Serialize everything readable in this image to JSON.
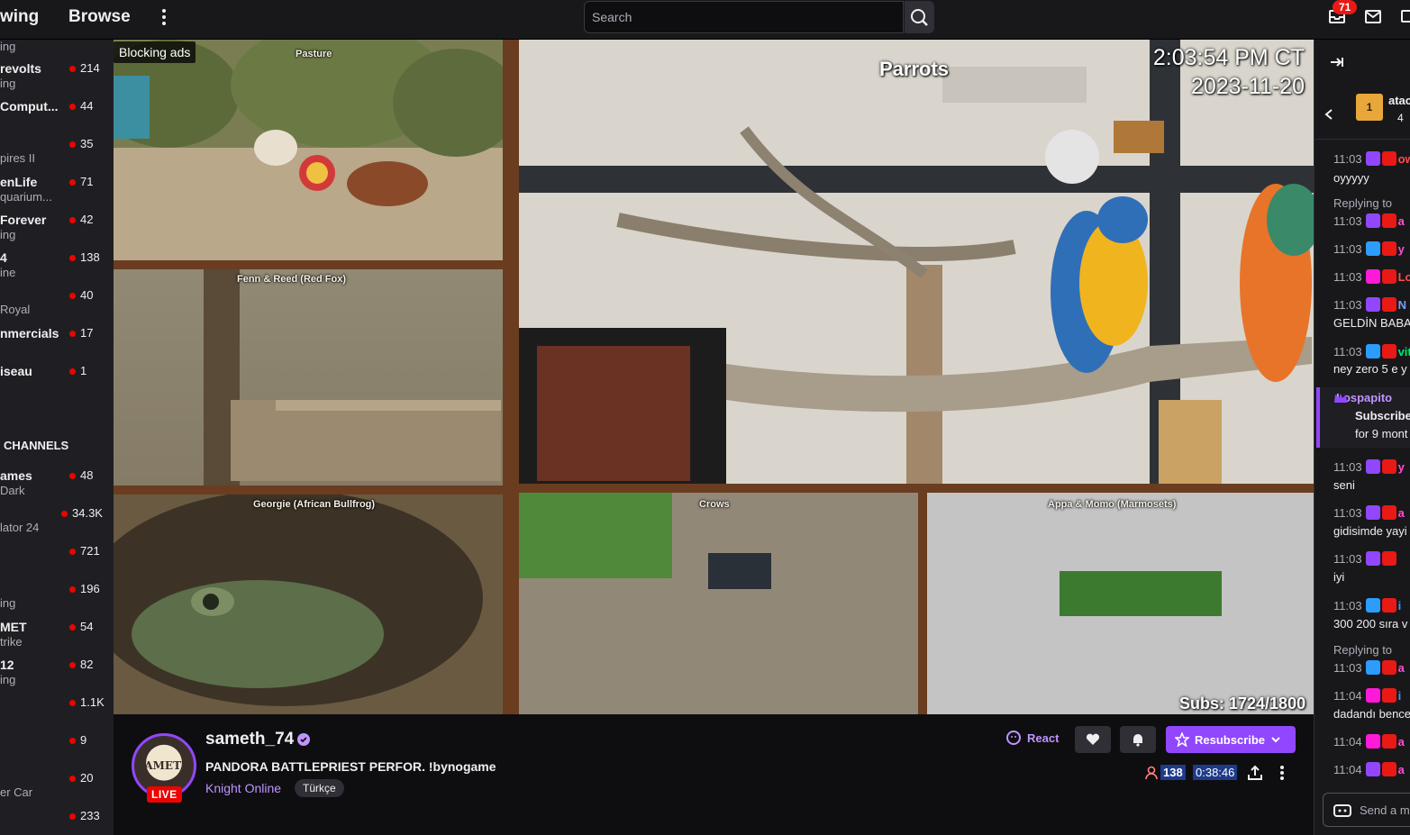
{
  "topnav": {
    "following_label": "wing",
    "browse_label": "Browse",
    "search_placeholder": "Search",
    "notifications_count": "71"
  },
  "sidebar": {
    "channels": [
      {
        "name": "",
        "game": "ing",
        "count": ""
      },
      {
        "name": "revolts",
        "game": "ing",
        "count": "214"
      },
      {
        "name": "Comput...",
        "game": "",
        "count": "44"
      },
      {
        "name": "",
        "game": "",
        "count": "35"
      },
      {
        "name": "",
        "game": "pires II",
        "count": ""
      },
      {
        "name": "enLife",
        "game": "quarium...",
        "count": "71"
      },
      {
        "name": "Forever",
        "game": "ing",
        "count": "42"
      },
      {
        "name": "4",
        "game": "ine",
        "count": "138"
      },
      {
        "name": "",
        "game": "",
        "count": "40"
      },
      {
        "name": "",
        "game": "Royal",
        "count": ""
      },
      {
        "name": "nmercials",
        "game": "",
        "count": "17"
      },
      {
        "name": "iseau",
        "game": "",
        "count": "1"
      }
    ],
    "heading": "CHANNELS",
    "recommended": [
      {
        "name": "ames",
        "game": "Dark",
        "count": "48"
      },
      {
        "name": "",
        "game": "",
        "count": "34.3K"
      },
      {
        "name": "",
        "game": "lator 24",
        "count": ""
      },
      {
        "name": "",
        "game": "",
        "count": "721"
      },
      {
        "name": "",
        "game": "",
        "count": "196"
      },
      {
        "name": "",
        "game": "ing",
        "count": ""
      },
      {
        "name": "MET",
        "game": "trike",
        "count": "54"
      },
      {
        "name": "12",
        "game": "ing",
        "count": "82"
      },
      {
        "name": "",
        "game": "",
        "count": "1.1K"
      },
      {
        "name": "",
        "game": "",
        "count": "9"
      },
      {
        "name": "",
        "game": "",
        "count": "20"
      },
      {
        "name": "",
        "game": "er Car",
        "count": ""
      },
      {
        "name": "",
        "game": "",
        "count": "233"
      }
    ]
  },
  "video": {
    "blocking_ads": "Blocking ads",
    "cam_labels": {
      "pasture": "Pasture",
      "fox": "Fenn & Reed (Red Fox)",
      "frog": "Georgie (African Bullfrog)",
      "crows": "Crows",
      "marmosets": "Appa & Momo (Marmosets)"
    },
    "parrots_label": "Parrots",
    "time": "2:03:54 PM CT",
    "date": "2023-11-20",
    "subs": "Subs: 1724/1800"
  },
  "channel": {
    "name": "sameth_74",
    "avatar_text": "SAMETH",
    "live": "LIVE",
    "title": "PANDORA BATTLEPRIEST PERFOR. !bynogame",
    "game": "Knight Online",
    "tag": "Türkçe",
    "react_label": "React",
    "resubscribe_label": "Resubscribe",
    "viewers": "138",
    "uptime": "0:38:46"
  },
  "chat": {
    "pinned_user": "atac",
    "pinned_count": "4",
    "lines": [
      {
        "time": "11:03",
        "user": "own",
        "color": "#ff4d4d",
        "text": ""
      },
      {
        "time": "",
        "user": "",
        "color": "#efeff1",
        "text": "oyyyyy"
      },
      {
        "time": "",
        "user": "",
        "color": "#adadb8",
        "text": "Replying to"
      },
      {
        "time": "11:03",
        "user": "a",
        "color": "#ff4dd2",
        "text": ""
      },
      {
        "time": "11:03",
        "user": "y",
        "color": "#ff4dd2",
        "text": ""
      },
      {
        "time": "11:03",
        "user": "Losp",
        "color": "#ff4d4d",
        "text": ""
      },
      {
        "time": "11:03",
        "user": "N",
        "color": "#7b9cff",
        "text": ""
      },
      {
        "time": "",
        "user": "",
        "color": "#efeff1",
        "text": "GELDİN BABA"
      },
      {
        "time": "11:03",
        "user": "vitalyzd",
        "color": "#00e676",
        "text": ""
      },
      {
        "time": "",
        "user": "",
        "color": "#efeff1",
        "text": "ney zero 5 e y"
      }
    ],
    "sub_notice": {
      "user": "Lospapito",
      "line1": "Subscribe",
      "line2": "for 9 mont"
    },
    "lines2": [
      {
        "time": "11:03",
        "user": "y",
        "color": "#ff4dd2",
        "text": ""
      },
      {
        "time": "",
        "user": "",
        "color": "#efeff1",
        "text": "seni"
      },
      {
        "time": "11:03",
        "user": "a",
        "color": "#ff4dd2",
        "text": ""
      },
      {
        "time": "",
        "user": "",
        "color": "#efeff1",
        "text": "gidisimde yayi"
      },
      {
        "time": "11:03",
        "user": "",
        "color": "#ff4dd2",
        "text": ""
      },
      {
        "time": "",
        "user": "",
        "color": "#efeff1",
        "text": "iyi"
      },
      {
        "time": "11:03",
        "user": "i",
        "color": "#2d9cff",
        "text": ""
      },
      {
        "time": "",
        "user": "",
        "color": "#efeff1",
        "text": "300 200 sıra v"
      },
      {
        "time": "",
        "user": "",
        "color": "#adadb8",
        "text": "Replying to"
      },
      {
        "time": "11:03",
        "user": "a",
        "color": "#ff4dd2",
        "text": ""
      },
      {
        "time": "11:04",
        "user": "i",
        "color": "#2d9cff",
        "text": ""
      },
      {
        "time": "",
        "user": "",
        "color": "#efeff1",
        "text": "dadandı bence"
      },
      {
        "time": "11:04",
        "user": "a",
        "color": "#ff4dd2",
        "text": ""
      },
      {
        "time": "11:04",
        "user": "a",
        "color": "#ff4dd2",
        "text": ""
      }
    ],
    "input_placeholder": "Send a m"
  }
}
